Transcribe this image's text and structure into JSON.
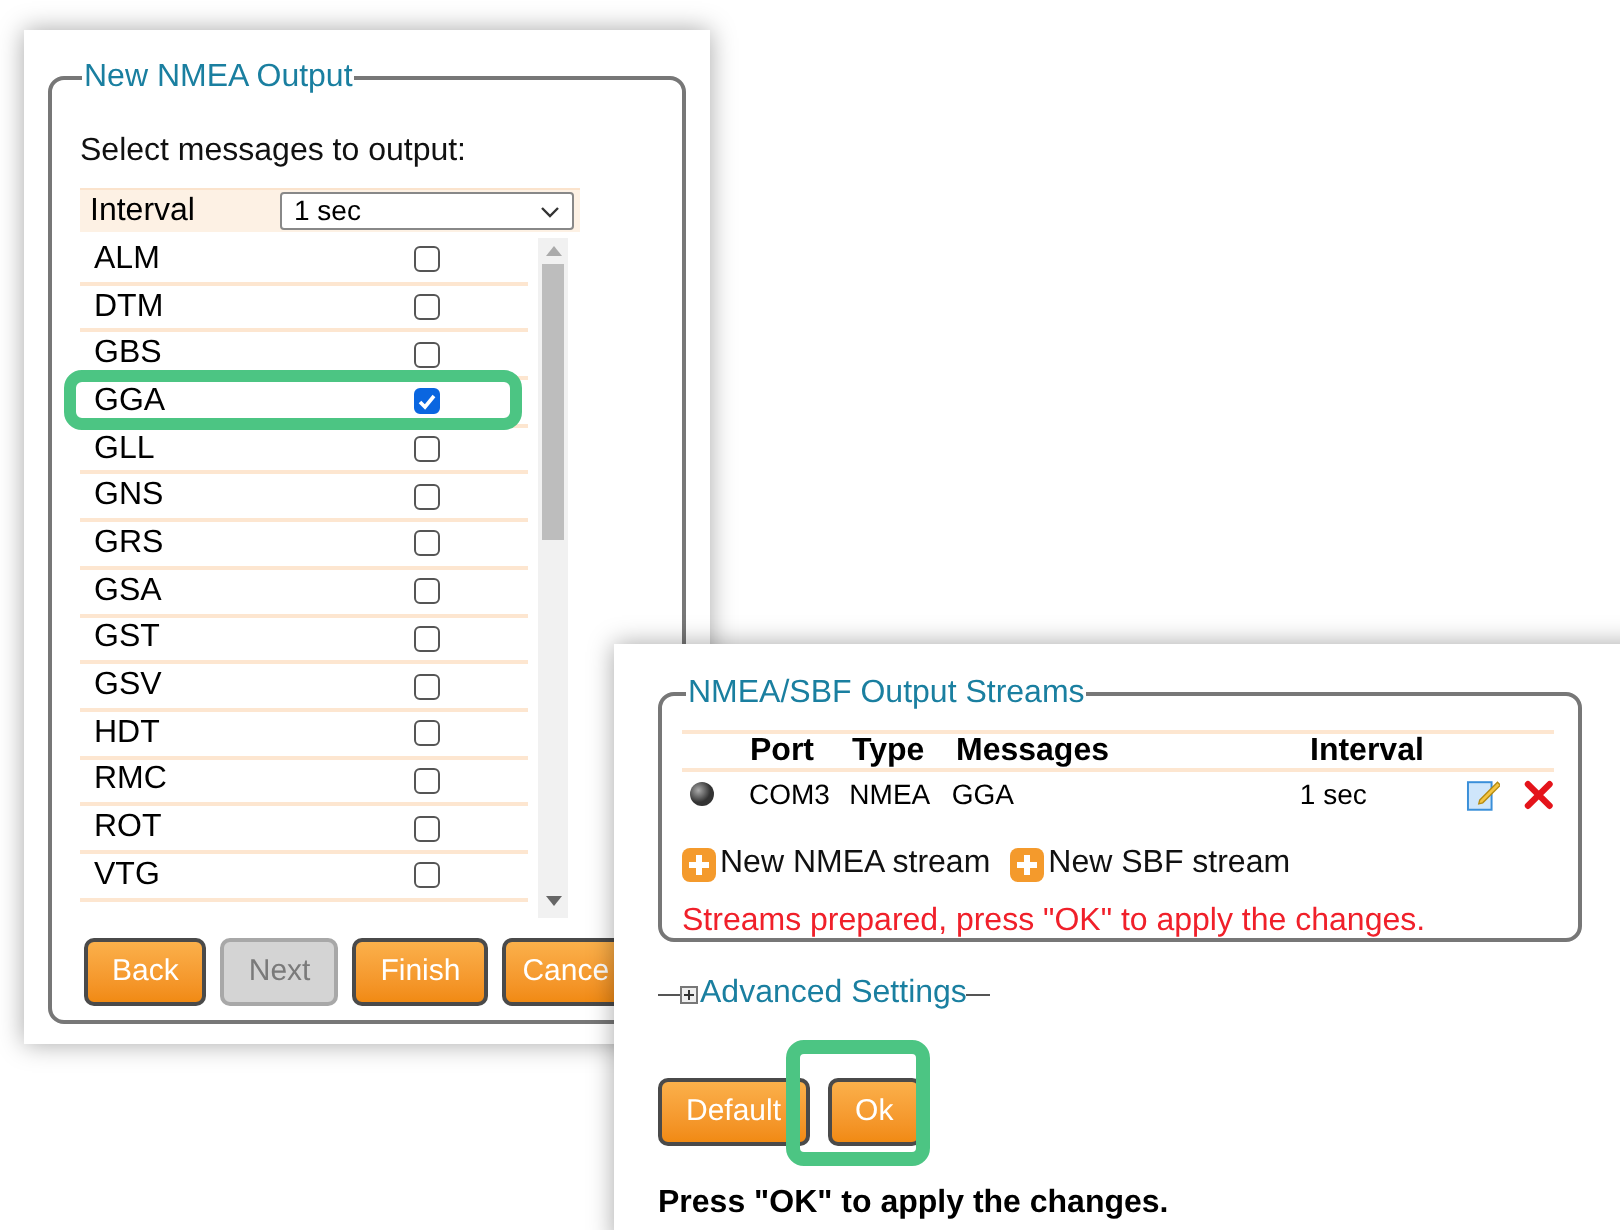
{
  "nmea_output": {
    "legend": "New NMEA Output",
    "prompt": "Select messages to output:",
    "interval_label": "Interval",
    "interval_value": "1 sec",
    "messages": [
      {
        "name": "ALM",
        "checked": false
      },
      {
        "name": "DTM",
        "checked": false
      },
      {
        "name": "GBS",
        "checked": false
      },
      {
        "name": "GGA",
        "checked": true
      },
      {
        "name": "GLL",
        "checked": false
      },
      {
        "name": "GNS",
        "checked": false
      },
      {
        "name": "GRS",
        "checked": false
      },
      {
        "name": "GSA",
        "checked": false
      },
      {
        "name": "GST",
        "checked": false
      },
      {
        "name": "GSV",
        "checked": false
      },
      {
        "name": "HDT",
        "checked": false
      },
      {
        "name": "RMC",
        "checked": false
      },
      {
        "name": "ROT",
        "checked": false
      },
      {
        "name": "VTG",
        "checked": false
      }
    ],
    "buttons": [
      {
        "label": "Back",
        "disabled": false
      },
      {
        "label": "Next",
        "disabled": true
      },
      {
        "label": "Finish",
        "disabled": false
      },
      {
        "label": "Cance",
        "disabled": false
      }
    ]
  },
  "output_streams": {
    "legend": "NMEA/SBF Output Streams",
    "columns": [
      "Port",
      "Type",
      "Messages",
      "Interval"
    ],
    "rows": [
      {
        "port": "COM3",
        "type": "NMEA",
        "messages": "GGA",
        "interval": "1 sec"
      }
    ],
    "links": [
      "New NMEA stream",
      "New SBF stream"
    ],
    "status": "Streams prepared, press \"OK\" to apply the changes.",
    "advanced": "Advanced Settings",
    "buttons": [
      "Default",
      "Ok"
    ],
    "footer": "Press \"OK\" to apply the changes."
  }
}
